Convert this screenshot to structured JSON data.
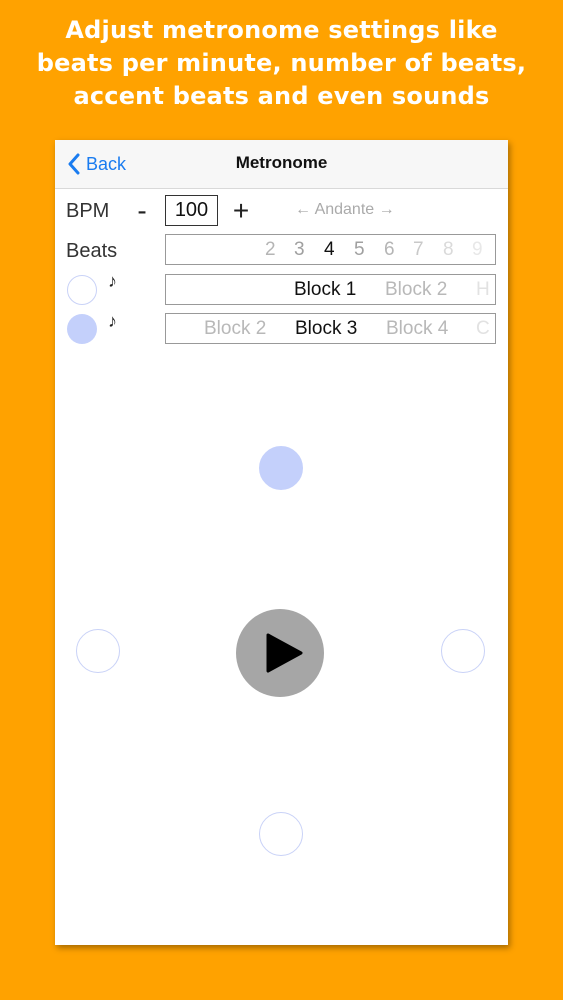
{
  "promo": {
    "line1": "Adjust metronome settings like",
    "line2": "beats per minute, number of beats,",
    "line3": "accent beats and even sounds"
  },
  "navbar": {
    "back_label": "Back",
    "title": "Metronome"
  },
  "bpm": {
    "label": "BPM",
    "minus": "-",
    "plus": "+",
    "value": "100",
    "tempo": "← Andante →"
  },
  "beats": {
    "label": "Beats",
    "options": [
      "2",
      "3",
      "4",
      "5",
      "6",
      "7",
      "8",
      "9"
    ],
    "selected": "4"
  },
  "sound_rows": [
    {
      "note": "♪",
      "options": [
        "Block 1",
        "Block 2",
        "H"
      ],
      "selected": "Block 1"
    },
    {
      "note": "♪",
      "options": [
        "",
        "Block 2",
        "Block 3",
        "Block 4",
        "C"
      ],
      "selected": "Block 3"
    }
  ],
  "colors": {
    "background": "#FFA200",
    "accent_blue": "#1a7cf0",
    "beat_active": "#c4d0fb"
  },
  "icons": {
    "back": "chevron-left-icon",
    "play": "play-icon"
  },
  "active_beat": 1
}
